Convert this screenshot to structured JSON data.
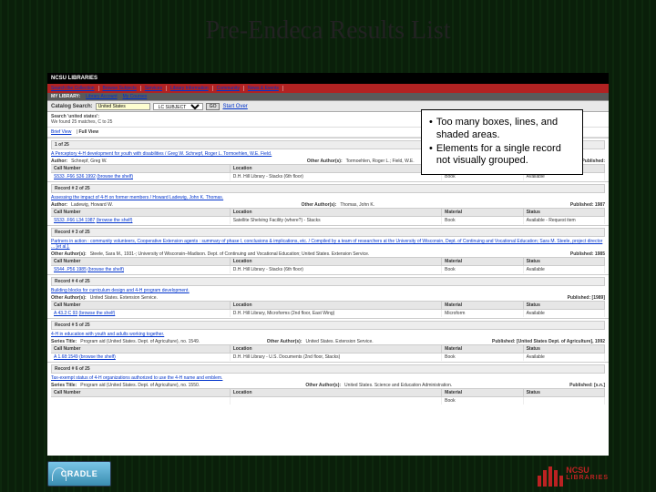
{
  "slide": {
    "title": "Pre-Endeca Results List"
  },
  "callout": {
    "lines": [
      "Too many boxes, lines, and shaded areas.",
      "Elements for a single record not visually grouped."
    ]
  },
  "topbar": {
    "brand": "NCSU LIBRARIES"
  },
  "nav": {
    "items": [
      "Search the Collection",
      "Browse Subjects",
      "Services",
      "Library Information",
      "Community",
      "News & Events"
    ]
  },
  "subnav": {
    "lead": "MY LIBRARY:",
    "items": [
      "Library Account",
      "My Courses"
    ]
  },
  "search": {
    "label": "Catalog Search:",
    "value": "United States",
    "dropdown": "LC SUBJECT",
    "go": "GO",
    "start_over": "Start Over"
  },
  "meta": {
    "heading": "Search 'united states':",
    "summary": "We found 25 matches, C to 25"
  },
  "views": {
    "brief": "Brief View",
    "full": "Full View"
  },
  "headers": {
    "call": "Call Number",
    "location": "Location",
    "material": "Material",
    "status": "Status"
  },
  "records": [
    {
      "head": "1 of 25",
      "title": "A Perceptory 4-H development for youth with disabilities / Greg W. Schnepf, Roger L. Tormoehlen, W.E. Field.",
      "author_label": "Author:",
      "author": "Schnepf, Greg W.",
      "other_label": "Other Author(s):",
      "other": "Tormoehlen, Roger L.; Field, W.E.",
      "pub_label": "Published:",
      "pub_year": "",
      "call": "S533 .F66 S36 1992",
      "browse": "(browse the shelf)",
      "location": "D.H. Hill Library - Stacks (6th floor)",
      "material": "Book",
      "status": "Available"
    },
    {
      "head": "Record # 2 of 25",
      "title": "Assessing the impact of 4-H on former members / Howard Ladewig, John K. Thomas.",
      "author_label": "Author:",
      "author": "Ladewig, Howard W.",
      "other_label": "Other Author(s):",
      "other": "Thomas, John K.",
      "pub_label": "Published:",
      "pub_year": "1987",
      "call": "S533 .F66 L34 1987",
      "browse": "(browse the shelf)",
      "location": "Satellite Shelving Facility (where?) - Stacks",
      "material": "Book",
      "status": "Available - Request item"
    },
    {
      "head": "Record # 3 of 25",
      "title": "Partners in action : community volunteers, Cooperative Extension agents : summary of phase I, conclusions & implications, etc. / Compiled by a team of researchers at the University of Wisconsin, Dept. of Continuing and Vocational Education; Sara M. Steele, project director ... [et al.].",
      "author_label": "Other Author(s):",
      "author": "Steele, Sara M., 1931-; University of Wisconsin–Madison. Dept. of Continuing and Vocational Education; United States. Extension Service.",
      "other_label": "",
      "other": "",
      "pub_label": "Published:",
      "pub_year": "1985",
      "call": "S544 .P56 1985",
      "browse": "(browse the shelf)",
      "location": "D.H. Hill Library - Stacks (6th floor)",
      "material": "Book",
      "status": "Available"
    },
    {
      "head": "Record # 4 of 25",
      "title": "Building blocks for curriculum design and 4-H program development.",
      "author_label": "Other Author(s):",
      "author": "United States. Extension Service.",
      "other_label": "",
      "other": "",
      "pub_label": "Published:",
      "pub_year": "[1989]",
      "call": "A 43.2:C 93",
      "browse": "(browse the shelf)",
      "location": "D.H. Hill Library, Microforms (2nd floor, East Wing)",
      "material": "Microform",
      "status": "Available"
    },
    {
      "head": "Record # 5 of 25",
      "title": "4-H in education with youth and adults working together.",
      "author_label": "Series Title:",
      "author": "Program aid (United States. Dept. of Agriculture), no. 1549.",
      "other_label": "Other Author(s):",
      "other": "United States. Extension Service.",
      "pub_label": "Published:",
      "pub_year": "[United States Dept. of Agriculture], 1992",
      "call": "A 1.68:1549",
      "browse": "(browse the shelf)",
      "location": "D.H. Hill Library - U.S. Documents (2nd floor, Stacks)",
      "material": "Book",
      "status": "Available"
    },
    {
      "head": "Record # 6 of 25",
      "title": "Tax-exempt status of 4-H organizations authorized to use the 4-H name and emblem.",
      "author_label": "Series Title:",
      "author": "Program aid (United States. Dept. of Agriculture), no. 1550.",
      "other_label": "Other Author(s):",
      "other": "United States. Science and Education Administration.",
      "pub_label": "Published:",
      "pub_year": "[s.n.]",
      "call": "",
      "browse": "",
      "location": "",
      "material": "Book",
      "status": ""
    }
  ],
  "logos": {
    "cradle": "CRADLE",
    "ncsu_line1": "NCSU",
    "ncsu_line2": "LIBRARIES"
  }
}
